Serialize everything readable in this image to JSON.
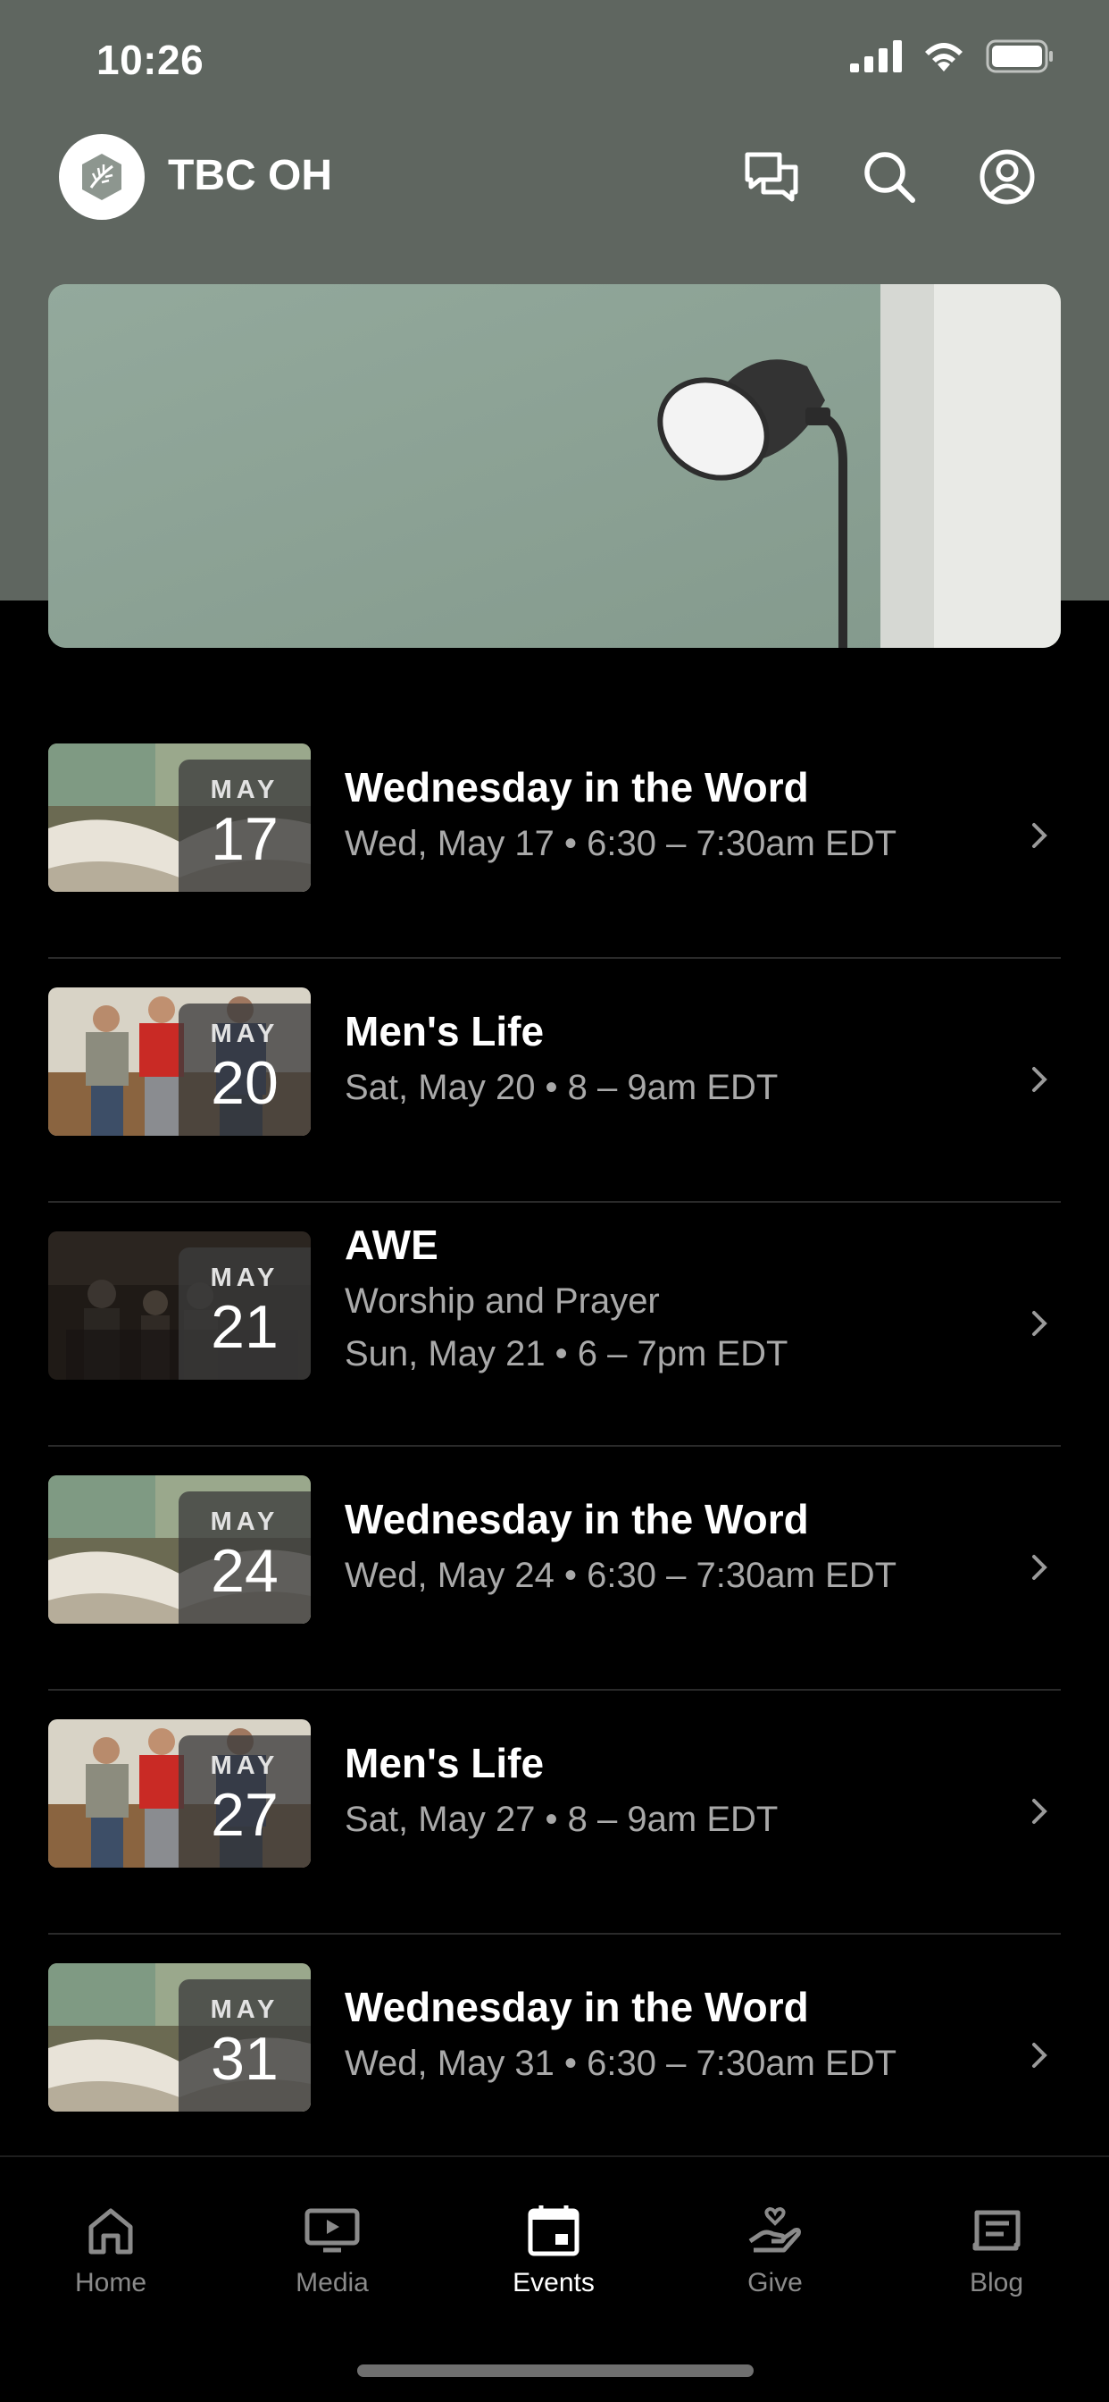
{
  "status_bar": {
    "time": "10:26"
  },
  "header": {
    "app_title": "TBC OH"
  },
  "events": [
    {
      "title": "Wednesday in the Word",
      "subtitle": "",
      "datetime": "Wed, May 17 • 6:30 – 7:30am EDT",
      "month": "MAY",
      "day": "17",
      "thumb": "book"
    },
    {
      "title": "Men's Life",
      "subtitle": "",
      "datetime": "Sat, May 20 • 8 – 9am EDT",
      "month": "MAY",
      "day": "20",
      "thumb": "men"
    },
    {
      "title": "AWE",
      "subtitle": "Worship and Prayer",
      "datetime": "Sun, May 21 • 6 – 7pm EDT",
      "month": "MAY",
      "day": "21",
      "thumb": "worship"
    },
    {
      "title": "Wednesday in the Word",
      "subtitle": "",
      "datetime": "Wed, May 24 • 6:30 – 7:30am EDT",
      "month": "MAY",
      "day": "24",
      "thumb": "book"
    },
    {
      "title": "Men's Life",
      "subtitle": "",
      "datetime": "Sat, May 27 • 8 – 9am EDT",
      "month": "MAY",
      "day": "27",
      "thumb": "men"
    },
    {
      "title": "Wednesday in the Word",
      "subtitle": "",
      "datetime": "Wed, May 31 • 6:30 – 7:30am EDT",
      "month": "MAY",
      "day": "31",
      "thumb": "book"
    }
  ],
  "tabs": [
    {
      "label": "Home",
      "icon": "home-icon",
      "active": false
    },
    {
      "label": "Media",
      "icon": "media-icon",
      "active": false
    },
    {
      "label": "Events",
      "icon": "calendar-icon",
      "active": true
    },
    {
      "label": "Give",
      "icon": "give-icon",
      "active": false
    },
    {
      "label": "Blog",
      "icon": "blog-icon",
      "active": false
    }
  ],
  "colors": {
    "header_bg": "#5f6660",
    "background": "#000000",
    "active_tab": "#ffffff",
    "inactive_tab": "#8a8a8a"
  }
}
